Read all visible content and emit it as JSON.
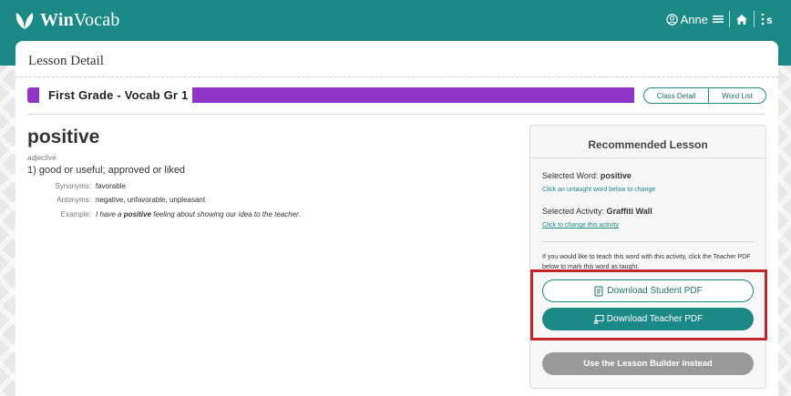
{
  "app": {
    "logo_prefix": "Win",
    "logo_suffix": "Vocab",
    "user": "Anne"
  },
  "page": {
    "title": "Lesson Detail"
  },
  "lesson": {
    "name": "First Grade - Vocab Gr 1",
    "color": "#8e35c8",
    "buttons": {
      "class_detail": "Class Detail",
      "word_list": "Word List"
    }
  },
  "word": {
    "text": "positive",
    "part_of_speech": "adjective",
    "definition": "1) good or useful; approved or liked",
    "synonyms_label": "Synonyms:",
    "synonyms": "favorable",
    "antonyms_label": "Antonyms:",
    "antonyms": "negative, unfavorable, unpleasant",
    "example_label": "Example:",
    "example_before": "I have a ",
    "example_word": "positive",
    "example_after": " feeling about showing our idea to the teacher."
  },
  "recommended": {
    "title": "Recommended Lesson",
    "selected_word_label": "Selected Word: ",
    "selected_word": "positive",
    "change_word_link": "Click an untaught word below to change",
    "selected_activity_label": "Selected Activity: ",
    "selected_activity": "Graffiti Wall",
    "change_activity_link": "Click to change this activity",
    "note": "If you would like to teach this word with this activity, click the Teacher PDF below to mark this word as taught.",
    "download_student": "Download Student PDF",
    "download_teacher": "Download Teacher PDF",
    "lesson_builder": "Use the Lesson Builder instead"
  },
  "colors": {
    "brand": "#1b8a87",
    "highlight": "#c0262b",
    "disabled": "#9a9a9a"
  }
}
